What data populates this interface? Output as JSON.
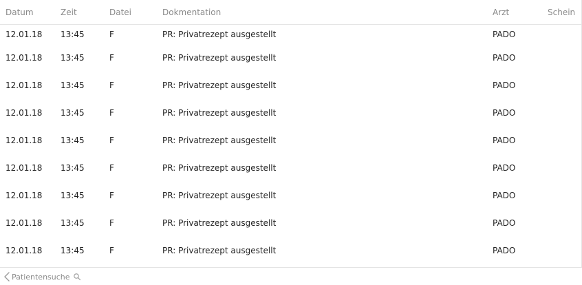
{
  "table": {
    "headers": {
      "datum": "Datum",
      "zeit": "Zeit",
      "datei": "Datei",
      "dokumentation": "Dokmentation",
      "arzt": "Arzt",
      "schein": "Schein"
    },
    "rows": [
      {
        "datum": "12.01.18",
        "zeit": "13:45",
        "datei": "F",
        "dokumentation": "PR: Privatrezept ausgestellt",
        "arzt": "PADO",
        "schein": ""
      },
      {
        "datum": "12.01.18",
        "zeit": "13:45",
        "datei": "F",
        "dokumentation": "PR: Privatrezept ausgestellt",
        "arzt": "PADO",
        "schein": ""
      },
      {
        "datum": "12.01.18",
        "zeit": "13:45",
        "datei": "F",
        "dokumentation": "PR: Privatrezept ausgestellt",
        "arzt": "PADO",
        "schein": ""
      },
      {
        "datum": "12.01.18",
        "zeit": "13:45",
        "datei": "F",
        "dokumentation": "PR: Privatrezept ausgestellt",
        "arzt": "PADO",
        "schein": ""
      },
      {
        "datum": "12.01.18",
        "zeit": "13:45",
        "datei": "F",
        "dokumentation": "PR: Privatrezept ausgestellt",
        "arzt": "PADO",
        "schein": ""
      },
      {
        "datum": "12.01.18",
        "zeit": "13:45",
        "datei": "F",
        "dokumentation": "PR: Privatrezept ausgestellt",
        "arzt": "PADO",
        "schein": ""
      },
      {
        "datum": "12.01.18",
        "zeit": "13:45",
        "datei": "F",
        "dokumentation": "PR: Privatrezept ausgestellt",
        "arzt": "PADO",
        "schein": ""
      },
      {
        "datum": "12.01.18",
        "zeit": "13:45",
        "datei": "F",
        "dokumentation": "PR: Privatrezept ausgestellt",
        "arzt": "PADO",
        "schein": ""
      },
      {
        "datum": "12.01.18",
        "zeit": "13:45",
        "datei": "F",
        "dokumentation": "PR: Privatrezept ausgestellt",
        "arzt": "PADO",
        "schein": ""
      }
    ]
  },
  "footer": {
    "back_label": "Patientensuche",
    "back_icon": "chevron-left-icon",
    "search_icon": "search-icon"
  },
  "colors": {
    "header_text": "#8a8a8a",
    "body_text": "#222222",
    "divider": "#e4e4e4"
  }
}
